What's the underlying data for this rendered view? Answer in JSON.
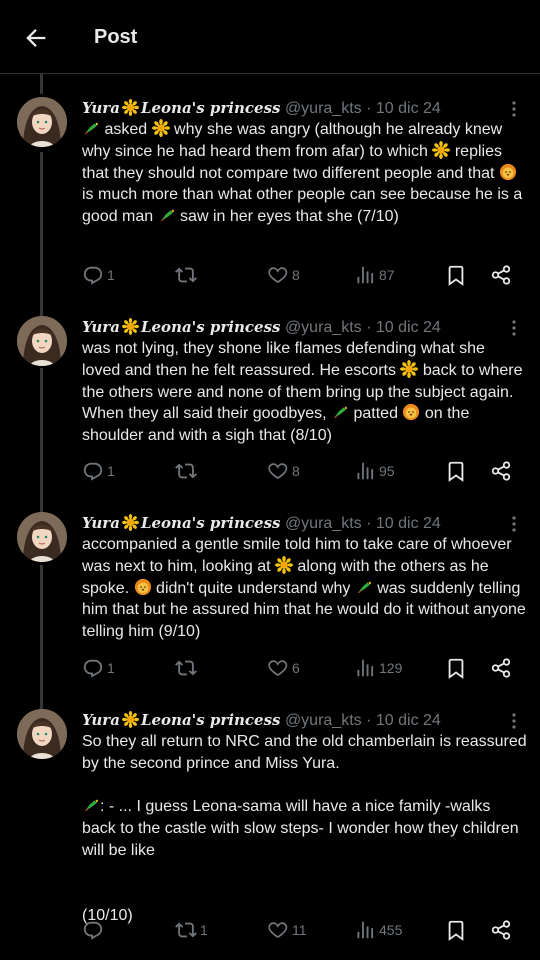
{
  "header": {
    "title": "Post"
  },
  "author": {
    "name_part1": "Yura",
    "name_part2": "Leona's princess",
    "handle": "@yura_kts",
    "separator": "·",
    "date": "10 dic 24"
  },
  "tweets": [
    {
      "segments": [
        {
          "emoji": "parrot-icon"
        },
        {
          "text": " asked "
        },
        {
          "emoji": "sun-icon"
        },
        {
          "text": " why she was angry (although he already knew why since he had heard them from afar) to which "
        },
        {
          "emoji": "sun-icon"
        },
        {
          "text": " replies that they should not compare two different people and that "
        },
        {
          "emoji": "lion-icon"
        },
        {
          "text": " is much more than what other people can see because he is a good man "
        },
        {
          "emoji": "parrot-icon"
        },
        {
          "text": " saw in her eyes that she (7/10)"
        }
      ],
      "replies": "1",
      "retweets": "",
      "likes": "8",
      "views": "87"
    },
    {
      "segments": [
        {
          "text": "was not lying, they shone like flames defending what she loved and then he felt reassured. He escorts "
        },
        {
          "emoji": "sun-icon"
        },
        {
          "text": " back to where the others were and none of them bring up the subject again. When they all said their goodbyes, "
        },
        {
          "emoji": "parrot-icon"
        },
        {
          "text": " patted "
        },
        {
          "emoji": "lion-icon"
        },
        {
          "text": " on the shoulder and with a sigh that (8/10)"
        }
      ],
      "replies": "1",
      "retweets": "",
      "likes": "8",
      "views": "95"
    },
    {
      "segments": [
        {
          "text": "accompanied a gentle smile told him to take care of whoever was next to him, looking at "
        },
        {
          "emoji": "sun-icon"
        },
        {
          "text": " along with the others as he spoke. "
        },
        {
          "emoji": "lion-icon"
        },
        {
          "text": " didn't quite understand why "
        },
        {
          "emoji": "parrot-icon"
        },
        {
          "text": " was suddenly telling him that but he assured him that he would do it without anyone telling him (9/10)"
        }
      ],
      "replies": "1",
      "retweets": "",
      "likes": "6",
      "views": "129"
    },
    {
      "segments": [
        {
          "text": "So they all return to NRC and the old chamberlain is reassured by the second prince and Miss Yura.\n\n"
        },
        {
          "emoji": "parrot-icon"
        },
        {
          "text": ": - ... I guess Leona-sama will have a nice family -walks back to the castle with slow steps- I wonder how they children will be like\n\n\n(10/10)"
        }
      ],
      "replies": "",
      "retweets": "1",
      "likes": "11",
      "views": "455"
    }
  ]
}
